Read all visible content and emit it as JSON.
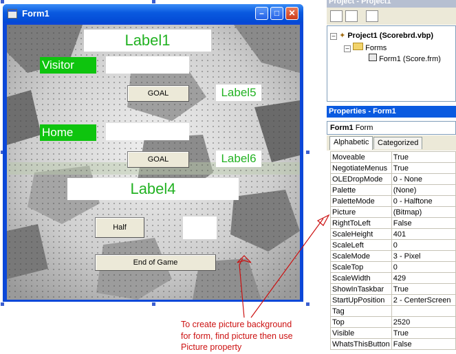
{
  "form": {
    "title": "Form1",
    "controls": {
      "label1": "Label1",
      "visitor": "Visitor",
      "goal1": "GOAL",
      "label5": "Label5",
      "home": "Home",
      "goal2": "GOAL",
      "label6": "Label6",
      "label4": "Label4",
      "half": "Half",
      "end_game": "End of Game"
    }
  },
  "project": {
    "title": "Project - Project1",
    "tree": {
      "root": "Project1 (Scorebrd.vbp)",
      "folder": "Forms",
      "form_item": "Form1 (Score.frm)"
    }
  },
  "properties": {
    "title": "Properties - Form1",
    "object": "Form1",
    "object_type": "Form",
    "tabs": [
      "Alphabetic",
      "Categorized"
    ],
    "rows": [
      {
        "name": "Moveable",
        "value": "True"
      },
      {
        "name": "NegotiateMenus",
        "value": "True"
      },
      {
        "name": "OLEDropMode",
        "value": "0 - None"
      },
      {
        "name": "Palette",
        "value": "(None)"
      },
      {
        "name": "PaletteMode",
        "value": "0 - Halftone"
      },
      {
        "name": "Picture",
        "value": "(Bitmap)"
      },
      {
        "name": "RightToLeft",
        "value": "False"
      },
      {
        "name": "ScaleHeight",
        "value": "401"
      },
      {
        "name": "ScaleLeft",
        "value": "0"
      },
      {
        "name": "ScaleMode",
        "value": "3 - Pixel"
      },
      {
        "name": "ScaleTop",
        "value": "0"
      },
      {
        "name": "ScaleWidth",
        "value": "429"
      },
      {
        "name": "ShowInTaskbar",
        "value": "True"
      },
      {
        "name": "StartUpPosition",
        "value": "2 - CenterScreen"
      },
      {
        "name": "Tag",
        "value": ""
      },
      {
        "name": "Top",
        "value": "2520"
      },
      {
        "name": "Visible",
        "value": "True"
      },
      {
        "name": "WhatsThisButton",
        "value": "False"
      }
    ]
  },
  "annotation": {
    "line1": "To create picture background",
    "line2": "for form, find picture then use",
    "line3": "Picture property",
    "color": "#cc1111"
  }
}
